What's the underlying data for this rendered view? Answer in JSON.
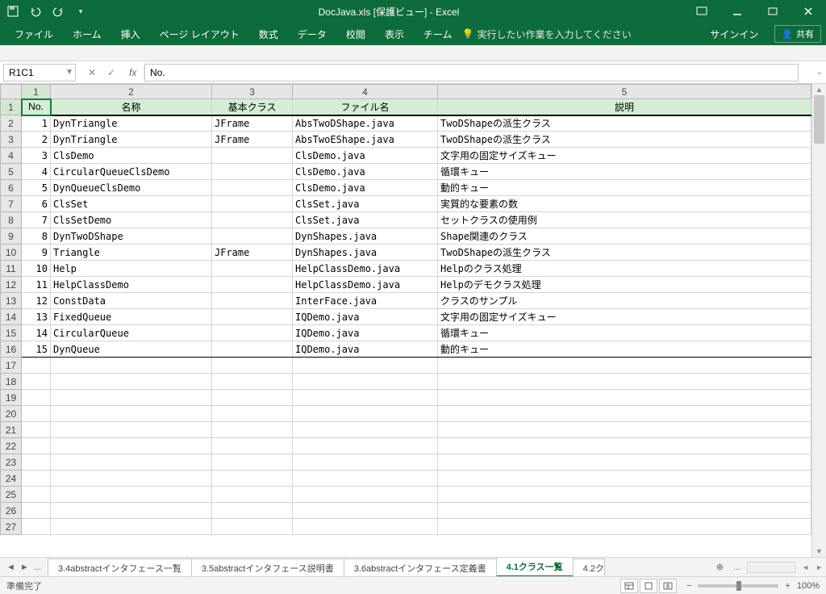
{
  "title": "DocJava.xls  [保護ビュー] - Excel",
  "qa_icons": [
    "save",
    "undo",
    "redo",
    "touch"
  ],
  "ribbon": {
    "tabs": [
      "ファイル",
      "ホーム",
      "挿入",
      "ページ レイアウト",
      "数式",
      "データ",
      "校閲",
      "表示",
      "チーム"
    ],
    "tell_me": "実行したい作業を入力してください",
    "signin": "サインイン",
    "share": "共有"
  },
  "name_box": "R1C1",
  "formula": "No.",
  "col_headers": [
    "1",
    "2",
    "3",
    "4",
    "5"
  ],
  "row_count": 27,
  "table_header": [
    "No.",
    "名称",
    "基本クラス",
    "ファイル名",
    "説明"
  ],
  "rows": [
    {
      "no": "1",
      "name": "DynTriangle",
      "base": "JFrame",
      "file": "AbsTwoDShape.java",
      "desc": "TwoDShapeの派生クラス"
    },
    {
      "no": "2",
      "name": "DynTriangle",
      "base": "JFrame",
      "file": "AbsTwoEShape.java",
      "desc": "TwoDShapeの派生クラス"
    },
    {
      "no": "3",
      "name": "ClsDemo",
      "base": "",
      "file": "ClsDemo.java",
      "desc": "文字用の固定サイズキュー"
    },
    {
      "no": "4",
      "name": "CircularQueueClsDemo",
      "base": "",
      "file": "ClsDemo.java",
      "desc": "循環キュー"
    },
    {
      "no": "5",
      "name": "DynQueueClsDemo",
      "base": "",
      "file": "ClsDemo.java",
      "desc": "動的キュー"
    },
    {
      "no": "6",
      "name": "ClsSet",
      "base": "",
      "file": "ClsSet.java",
      "desc": "実質的な要素の数"
    },
    {
      "no": "7",
      "name": "ClsSetDemo",
      "base": "",
      "file": "ClsSet.java",
      "desc": "セットクラスの使用例"
    },
    {
      "no": "8",
      "name": "DynTwoDShape",
      "base": "",
      "file": "DynShapes.java",
      "desc": "Shape関連のクラス"
    },
    {
      "no": "9",
      "name": "Triangle",
      "base": "JFrame",
      "file": "DynShapes.java",
      "desc": "TwoDShapeの派生クラス"
    },
    {
      "no": "10",
      "name": "Help",
      "base": "",
      "file": "HelpClassDemo.java",
      "desc": "Helpのクラス処理"
    },
    {
      "no": "11",
      "name": "HelpClassDemo",
      "base": "",
      "file": "HelpClassDemo.java",
      "desc": "Helpのデモクラス処理"
    },
    {
      "no": "12",
      "name": "ConstData",
      "base": "",
      "file": "InterFace.java",
      "desc": "クラスのサンプル"
    },
    {
      "no": "13",
      "name": "FixedQueue",
      "base": "",
      "file": "IQDemo.java",
      "desc": "文字用の固定サイズキュー"
    },
    {
      "no": "14",
      "name": "CircularQueue",
      "base": "",
      "file": "IQDemo.java",
      "desc": "循環キュー"
    },
    {
      "no": "15",
      "name": "DynQueue",
      "base": "",
      "file": "IQDemo.java",
      "desc": "動的キュー"
    }
  ],
  "sheet_tabs": {
    "left_more": "...",
    "items": [
      "3.4abstractインタフェース一覧",
      "3.5abstractインタフェース説明書",
      "3.6abstractインタフェース定義書",
      "4.1クラス一覧",
      "4.2ク"
    ],
    "active_index": 3
  },
  "status": {
    "ready": "準備完了",
    "zoom": "100%"
  }
}
